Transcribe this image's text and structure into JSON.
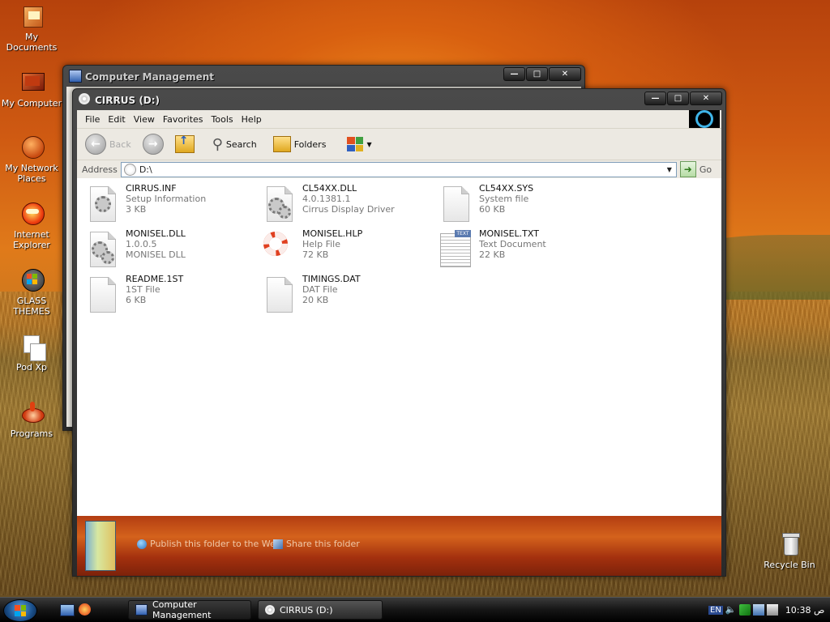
{
  "desktop": {
    "icons": [
      {
        "label": "My Documents"
      },
      {
        "label": "My Computer"
      },
      {
        "label": "My Network Places"
      },
      {
        "label": "Internet Explorer"
      },
      {
        "label": "GLASS THEMES"
      },
      {
        "label": "Pod Xp"
      },
      {
        "label": "Programs"
      },
      {
        "label": "Recycle Bin"
      }
    ]
  },
  "bg_window": {
    "title": "Computer Management"
  },
  "explorer": {
    "title": "CIRRUS (D:)",
    "menu": [
      "File",
      "Edit",
      "View",
      "Favorites",
      "Tools",
      "Help"
    ],
    "toolbar": {
      "back_label": "Back",
      "search_label": "Search",
      "folders_label": "Folders"
    },
    "address": {
      "label": "Address",
      "value": "D:\\",
      "go_label": "Go"
    },
    "files": [
      {
        "name": "CIRRUS.INF",
        "type": "Setup Information",
        "size": "3 KB",
        "icon": "gear-doc-icon"
      },
      {
        "name": "CL54XX.DLL",
        "type": "4.0.1381.1",
        "size": "Cirrus Display Driver",
        "icon": "gear-doc-icon"
      },
      {
        "name": "CL54XX.SYS",
        "type": "System file",
        "size": "60 KB",
        "icon": "blank-doc-icon"
      },
      {
        "name": "MONISEL.DLL",
        "type": "1.0.0.5",
        "size": "MONISEL DLL",
        "icon": "gear-doc-icon"
      },
      {
        "name": "MONISEL.HLP",
        "type": "Help File",
        "size": "72 KB",
        "icon": "lifebuoy-icon"
      },
      {
        "name": "MONISEL.TXT",
        "type": "Text Document",
        "size": "22 KB",
        "icon": "text-doc-icon"
      },
      {
        "name": "README.1ST",
        "type": "1ST File",
        "size": "6 KB",
        "icon": "blank-doc-icon"
      },
      {
        "name": "TIMINGS.DAT",
        "type": "DAT File",
        "size": "20 KB",
        "icon": "blank-doc-icon"
      }
    ],
    "tasks": {
      "publish": "Publish this folder to the Web",
      "share": "Share this folder"
    }
  },
  "taskbar": {
    "buttons": [
      {
        "label": "Computer Management"
      },
      {
        "label": "CIRRUS (D:)"
      }
    ],
    "lang": "EN",
    "clock": "10:38 ص"
  }
}
